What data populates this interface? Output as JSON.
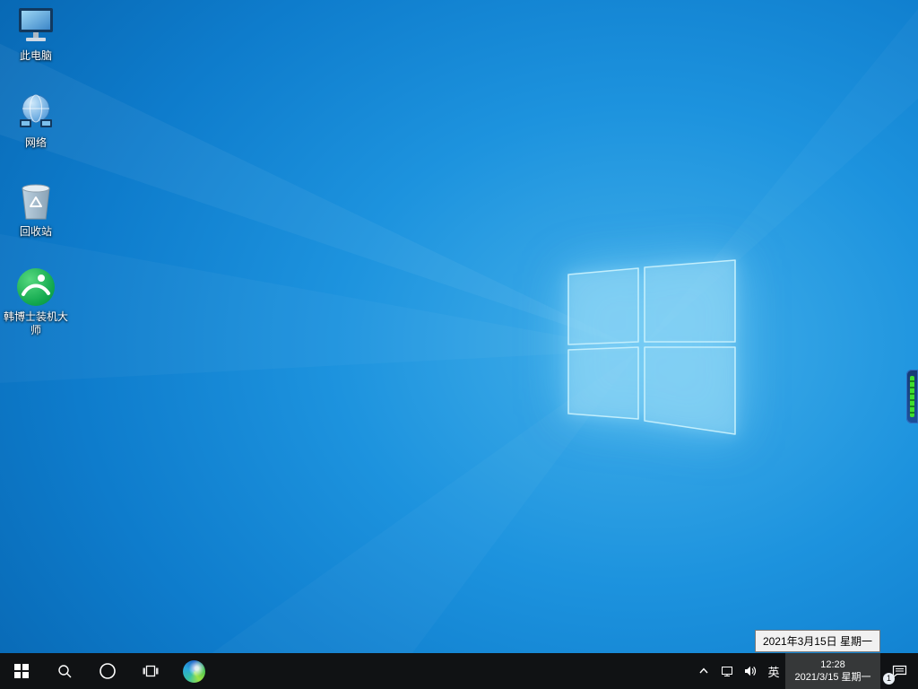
{
  "desktop": {
    "icons": [
      {
        "id": "this-pc",
        "label": "此电脑"
      },
      {
        "id": "network",
        "label": "网络"
      },
      {
        "id": "recycle-bin",
        "label": "回收站"
      },
      {
        "id": "hanboshi",
        "label": "韩博士装机大师"
      }
    ]
  },
  "taskbar": {
    "buttons": [
      {
        "id": "start"
      },
      {
        "id": "search"
      },
      {
        "id": "cortana"
      },
      {
        "id": "task-view"
      },
      {
        "id": "edge"
      }
    ],
    "tray": {
      "input_indicator": "英",
      "time": "12:28",
      "date": "2021/3/15 星期一",
      "notification_badge": "1"
    }
  },
  "tooltip": {
    "text": "2021年3月15日 星期一"
  },
  "colors": {
    "wallpaper_blue": "#0e7ccc",
    "taskbar": "#101214",
    "tooltip_bg": "#f1f1f1",
    "widget_green": "#3ede2e"
  }
}
